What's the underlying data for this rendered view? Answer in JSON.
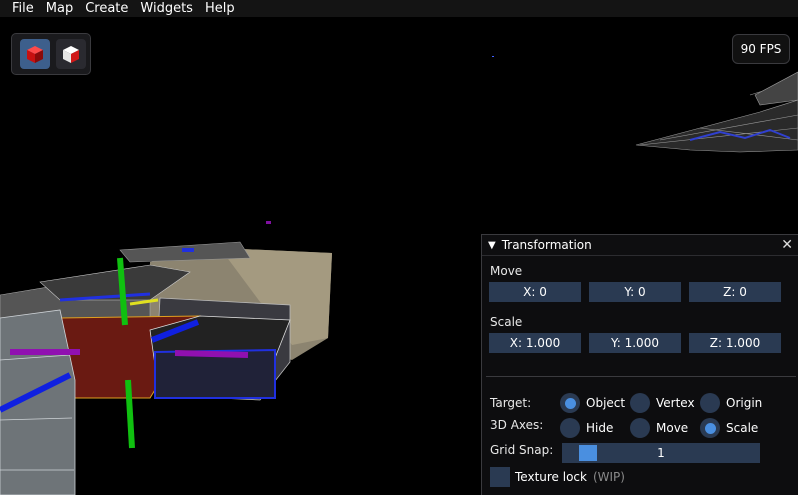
{
  "menubar": {
    "items": [
      "File",
      "Map",
      "Create",
      "Widgets",
      "Help"
    ]
  },
  "toolbar": {
    "tools": [
      "solid-cube-icon",
      "wire-cube-icon"
    ]
  },
  "fps": {
    "label": "90 FPS"
  },
  "panel": {
    "title": "Transformation",
    "move": {
      "label": "Move",
      "x": "X: 0",
      "y": "Y: 0",
      "z": "Z: 0"
    },
    "scale": {
      "label": "Scale",
      "x": "X: 1.000",
      "y": "Y: 1.000",
      "z": "Z: 1.000"
    },
    "target": {
      "label": "Target:",
      "options": [
        "Object",
        "Vertex",
        "Origin"
      ],
      "selected": "Object"
    },
    "axes": {
      "label": "3D Axes:",
      "options": [
        "Hide",
        "Move",
        "Scale"
      ],
      "selected": "Scale"
    },
    "grid_snap": {
      "label": "Grid Snap:",
      "value": "1"
    },
    "texture_lock": {
      "label": "Texture lock",
      "note": "(WIP)"
    }
  },
  "colors": {
    "accent": "#4a8fe0",
    "field": "#2a3a52",
    "menubar": "#141414"
  }
}
